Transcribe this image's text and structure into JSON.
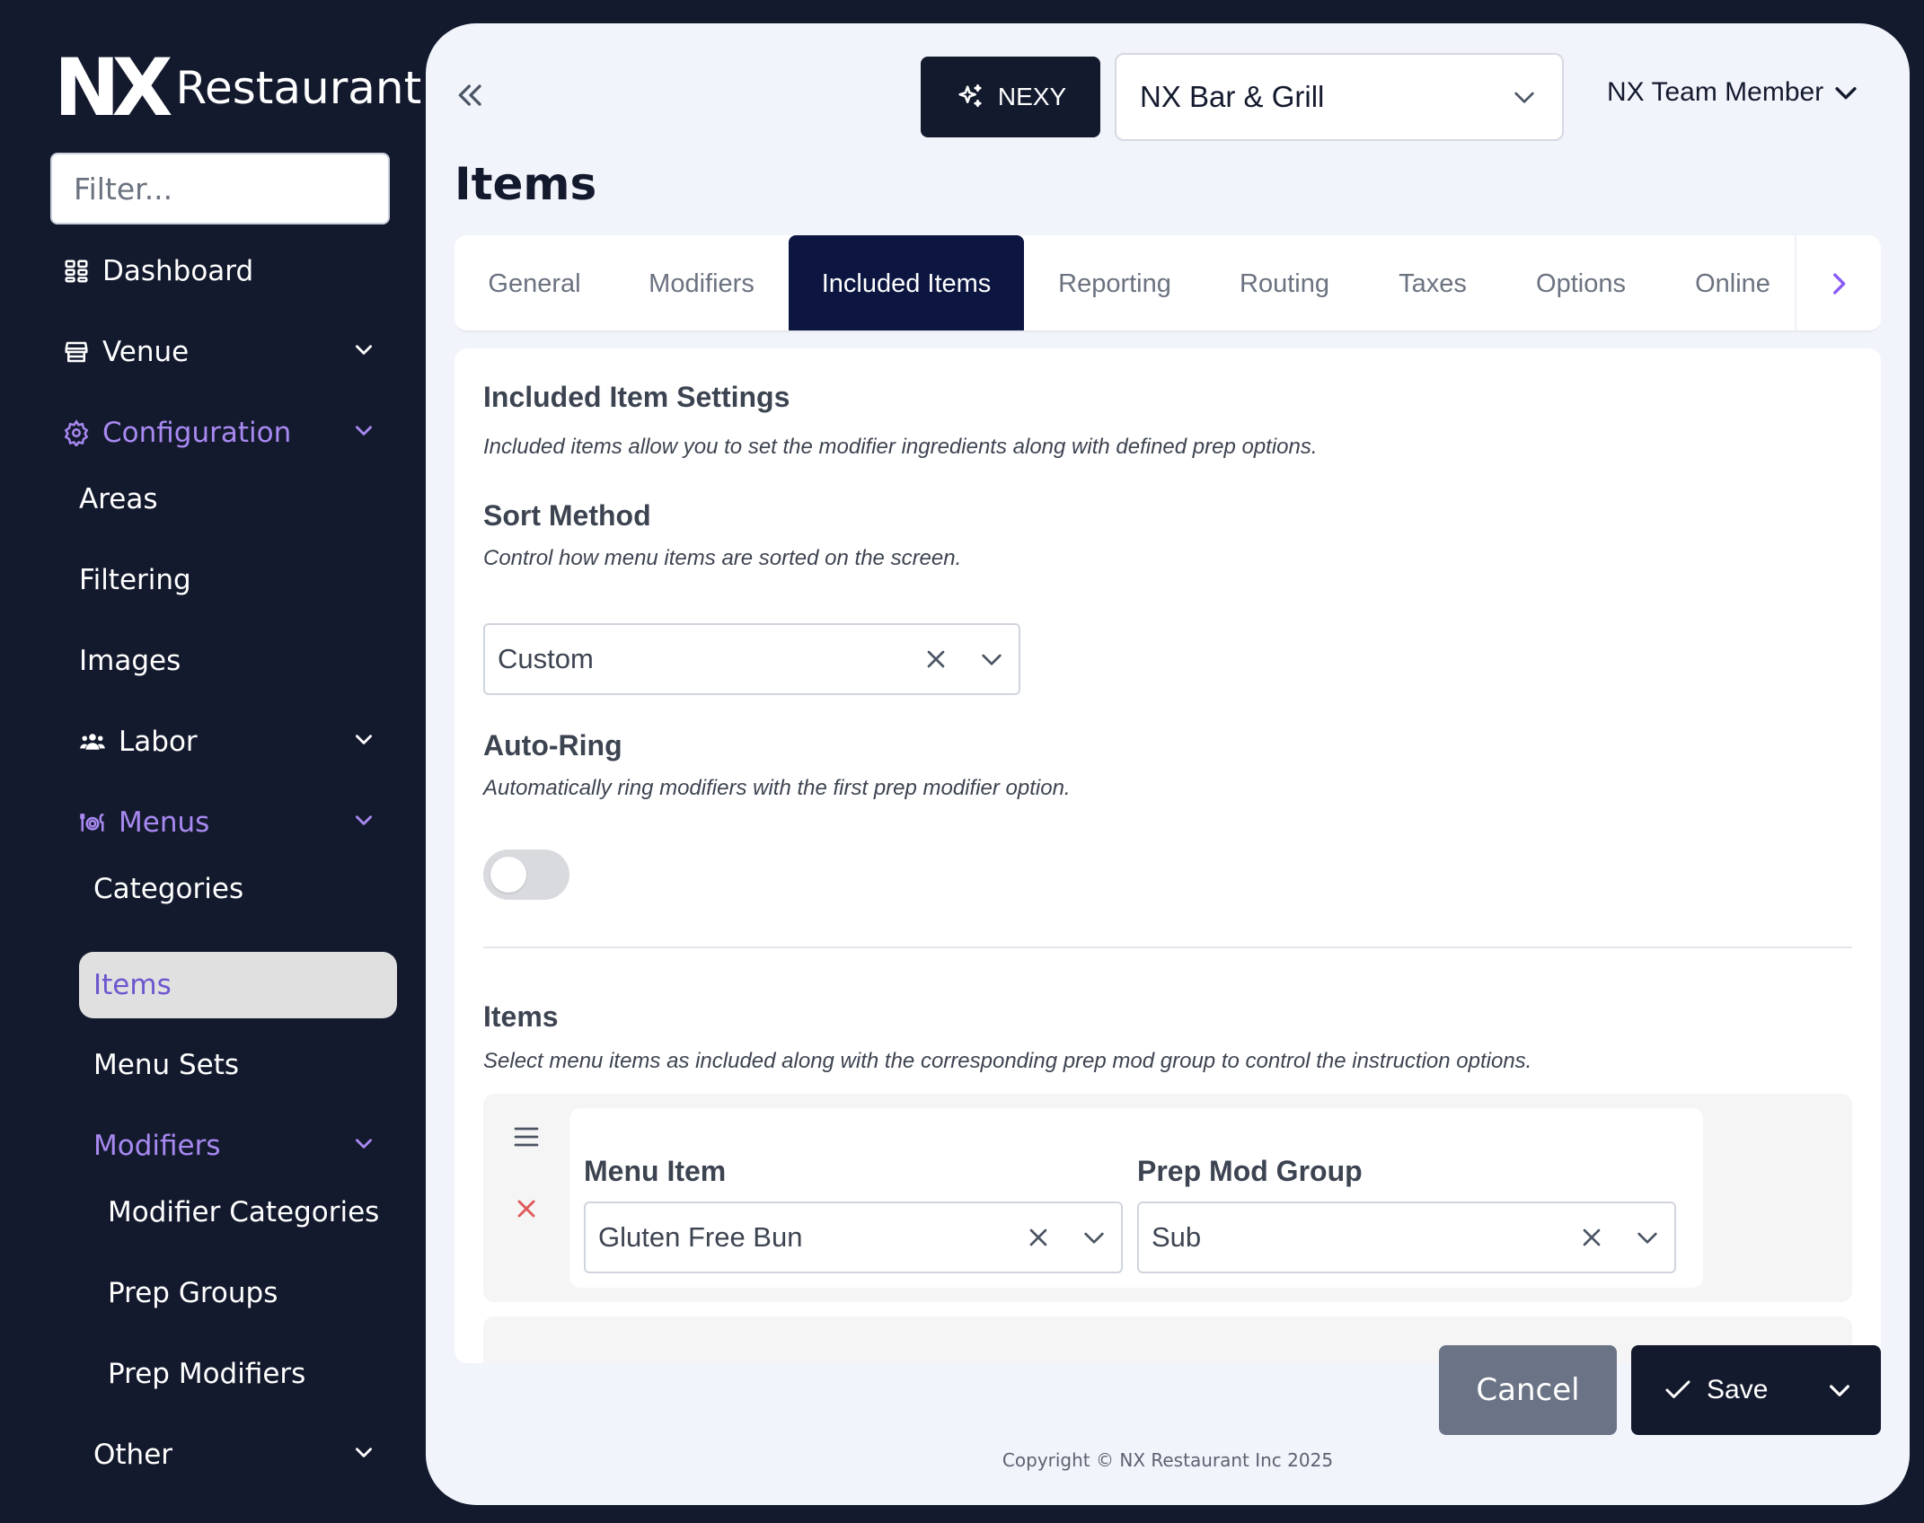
{
  "brand": {
    "mark": "NX",
    "name": "Restaurant"
  },
  "sidebar": {
    "filter_placeholder": "Filter...",
    "dashboard": "Dashboard",
    "venue": "Venue",
    "configuration": "Configuration",
    "config_children": [
      "Areas",
      "Filtering",
      "Images"
    ],
    "labor": "Labor",
    "menus": "Menus",
    "menus_children": [
      "Categories",
      "Items",
      "Menu Sets"
    ],
    "modifiers": "Modifiers",
    "modifiers_children": [
      "Modifier Categories",
      "Prep Groups",
      "Prep Modifiers"
    ],
    "other": "Other",
    "active_item": "Items"
  },
  "header": {
    "nexy_label": "NEXY",
    "venue_selected": "NX Bar & Grill",
    "user_label": "NX Team Member"
  },
  "page": {
    "title": "Items"
  },
  "tabs": [
    "General",
    "Modifiers",
    "Included Items",
    "Reporting",
    "Routing",
    "Taxes",
    "Options",
    "Online"
  ],
  "active_tab": "Included Items",
  "settings": {
    "title": "Included Item Settings",
    "desc": "Included items allow you to set the modifier ingredients along with defined prep options.",
    "sort_title": "Sort Method",
    "sort_desc": "Control how menu items are sorted on the screen.",
    "sort_value": "Custom",
    "autoring_title": "Auto-Ring",
    "autoring_desc": "Automatically ring modifiers with the first prep modifier option.",
    "autoring_enabled": false
  },
  "items_section": {
    "title": "Items",
    "desc": "Select menu items as included along with the corresponding prep mod group to control the instruction options.",
    "menu_item_label": "Menu Item",
    "prep_group_label": "Prep Mod Group",
    "rows": [
      {
        "menu_item": "Gluten Free Bun",
        "prep_group": "Sub"
      }
    ]
  },
  "footer": {
    "cancel": "Cancel",
    "save": "Save",
    "copyright": "Copyright © NX Restaurant Inc 2025"
  },
  "colors": {
    "sidebar_bg": "#141a2e",
    "accent_purple": "#a889f1",
    "active_tab_bg": "#0c1640",
    "danger": "#e05a5a",
    "cancel_bg": "#6b7486"
  }
}
